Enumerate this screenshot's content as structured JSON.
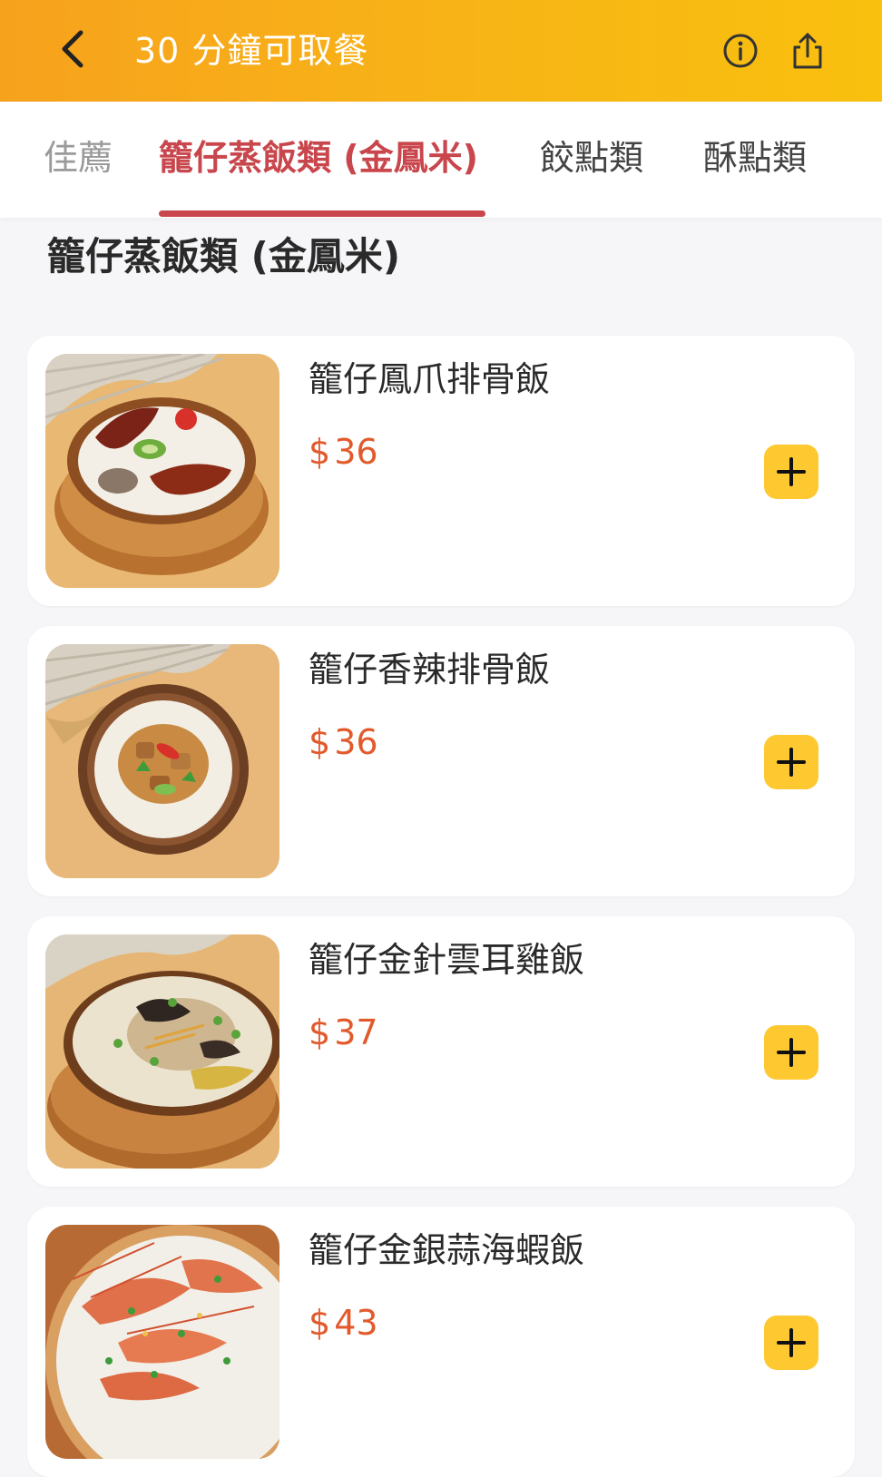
{
  "header": {
    "title": "30 分鐘可取餐",
    "back_icon": "chevron-left-icon",
    "info_icon": "info-icon",
    "share_icon": "share-icon",
    "colors": {
      "start": "#f7a21d",
      "end": "#f9c00e"
    }
  },
  "tabs": [
    {
      "label": "佳薦",
      "state": "partially-visible"
    },
    {
      "label": "籠仔蒸飯類 (金鳳米)",
      "state": "active"
    },
    {
      "label": "餃點類",
      "state": "normal"
    },
    {
      "label": "酥點類",
      "state": "normal"
    }
  ],
  "section": {
    "title": "籠仔蒸飯類 (金鳳米)"
  },
  "items": [
    {
      "name": "籠仔鳳爪排骨飯",
      "currency": "$",
      "price": "36"
    },
    {
      "name": "籠仔香辣排骨飯",
      "currency": "$",
      "price": "36"
    },
    {
      "name": "籠仔金針雲耳雞飯",
      "currency": "$",
      "price": "37"
    },
    {
      "name": "籠仔金銀蒜海蝦飯",
      "currency": "$",
      "price": "43"
    }
  ],
  "colors": {
    "accent_active_tab": "#c8464c",
    "price": "#e25a2c",
    "add_button": "#fdc830"
  }
}
